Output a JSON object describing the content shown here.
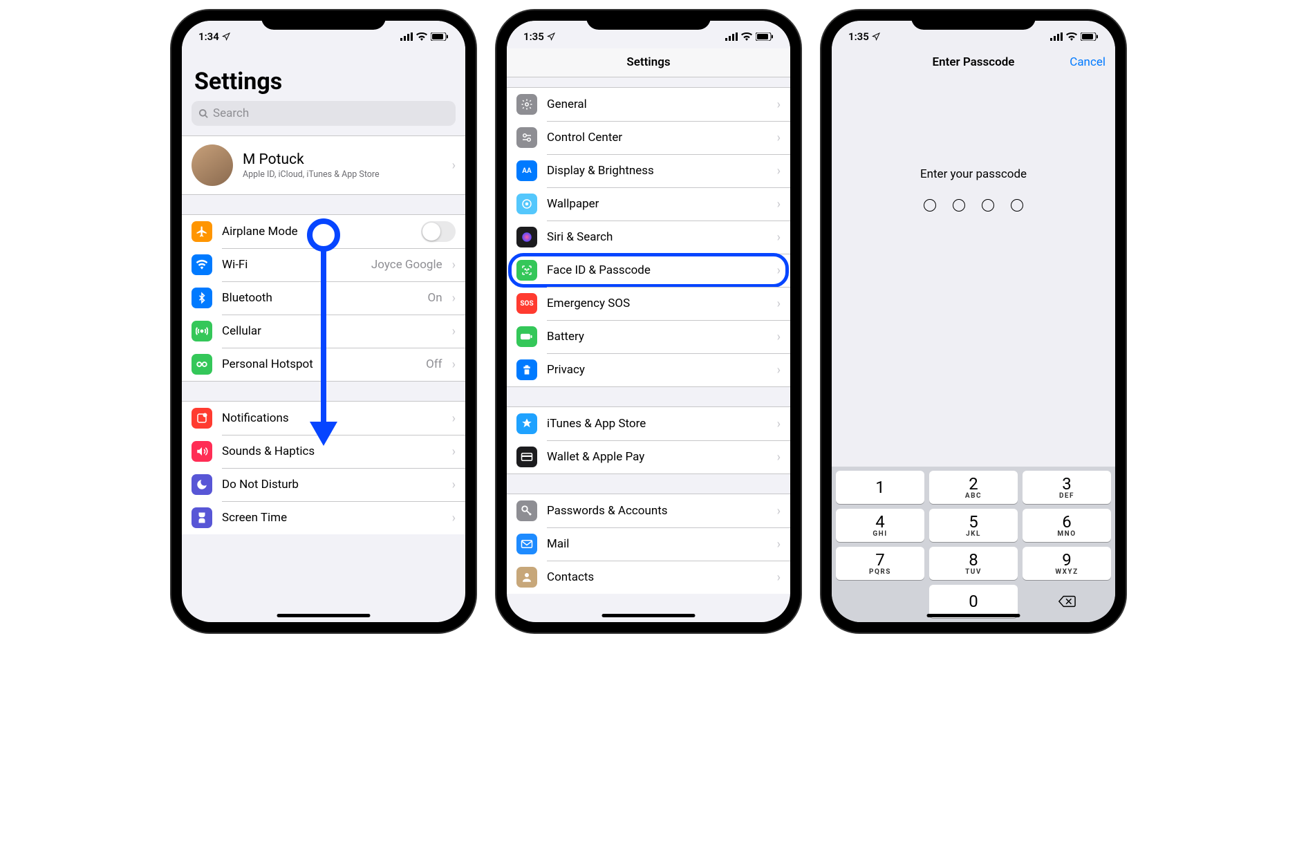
{
  "colors": {
    "accent": "#007aff",
    "annotation": "#0645ff"
  },
  "status_bar": {
    "time_a": "1:34",
    "time_b": "1:35",
    "time_c": "1:35"
  },
  "phone1": {
    "title": "Settings",
    "search_placeholder": "Search",
    "profile": {
      "name": "M Potuck",
      "subtitle": "Apple ID, iCloud, iTunes & App Store"
    },
    "group1": [
      {
        "icon": "airplane-icon",
        "label": "Airplane Mode",
        "control": "toggle",
        "bg": "#ff9500"
      },
      {
        "icon": "wifi-icon",
        "label": "Wi-Fi",
        "detail": "Joyce Google",
        "bg": "#007aff"
      },
      {
        "icon": "bluetooth-icon",
        "label": "Bluetooth",
        "detail": "On",
        "bg": "#007aff"
      },
      {
        "icon": "cellular-icon",
        "label": "Cellular",
        "detail": "",
        "bg": "#34c759"
      },
      {
        "icon": "hotspot-icon",
        "label": "Personal Hotspot",
        "detail": "Off",
        "bg": "#34c759"
      }
    ],
    "group2": [
      {
        "icon": "notifications-icon",
        "label": "Notifications",
        "bg": "#ff3b30"
      },
      {
        "icon": "sounds-icon",
        "label": "Sounds & Haptics",
        "bg": "#ff2d55"
      },
      {
        "icon": "dnd-icon",
        "label": "Do Not Disturb",
        "bg": "#5856d6"
      },
      {
        "icon": "screentime-icon",
        "label": "Screen Time",
        "bg": "#5856d6"
      }
    ]
  },
  "phone2": {
    "nav_title": "Settings",
    "groupA": [
      {
        "icon": "general-icon",
        "label": "General",
        "bg": "#8e8e93"
      },
      {
        "icon": "controlcenter-icon",
        "label": "Control Center",
        "bg": "#8e8e93"
      },
      {
        "icon": "display-icon",
        "label": "Display & Brightness",
        "bg": "#007aff",
        "text": "AA"
      },
      {
        "icon": "wallpaper-icon",
        "label": "Wallpaper",
        "bg": "#54c7fc"
      },
      {
        "icon": "siri-icon",
        "label": "Siri & Search",
        "bg": "#1c1c1e"
      },
      {
        "icon": "faceid-icon",
        "label": "Face ID & Passcode",
        "bg": "#34c759",
        "highlight": true
      },
      {
        "icon": "sos-icon",
        "label": "Emergency SOS",
        "bg": "#ff3b30",
        "text": "SOS"
      },
      {
        "icon": "battery-icon",
        "label": "Battery",
        "bg": "#34c759"
      },
      {
        "icon": "privacy-icon",
        "label": "Privacy",
        "bg": "#007aff"
      }
    ],
    "groupB": [
      {
        "icon": "appstore-icon",
        "label": "iTunes & App Store",
        "bg": "#1fa2ff"
      },
      {
        "icon": "wallet-icon",
        "label": "Wallet & Apple Pay",
        "bg": "#1c1c1e"
      }
    ],
    "groupC": [
      {
        "icon": "passwords-icon",
        "label": "Passwords & Accounts",
        "bg": "#8e8e93"
      },
      {
        "icon": "mail-icon",
        "label": "Mail",
        "bg": "#1e8bff"
      },
      {
        "icon": "contacts-icon",
        "label": "Contacts",
        "bg": "#c7a77a"
      }
    ]
  },
  "phone3": {
    "nav_title": "Enter Passcode",
    "cancel": "Cancel",
    "prompt": "Enter your passcode",
    "passcode_length": 4,
    "keypad": [
      {
        "num": "1",
        "let": ""
      },
      {
        "num": "2",
        "let": "ABC"
      },
      {
        "num": "3",
        "let": "DEF"
      },
      {
        "num": "4",
        "let": "GHI"
      },
      {
        "num": "5",
        "let": "JKL"
      },
      {
        "num": "6",
        "let": "MNO"
      },
      {
        "num": "7",
        "let": "PQRS"
      },
      {
        "num": "8",
        "let": "TUV"
      },
      {
        "num": "9",
        "let": "WXYZ"
      },
      {
        "blank": true
      },
      {
        "num": "0",
        "let": ""
      },
      {
        "backspace": true
      }
    ]
  }
}
